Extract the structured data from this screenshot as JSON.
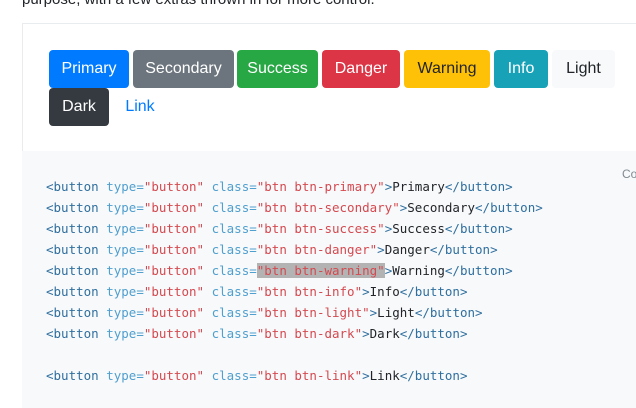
{
  "intro_text": "purpose, with a few extras thrown in for more control.",
  "buttons": [
    {
      "label": "Primary",
      "variant": "primary"
    },
    {
      "label": "Secondary",
      "variant": "secondary"
    },
    {
      "label": "Success",
      "variant": "success"
    },
    {
      "label": "Danger",
      "variant": "danger"
    },
    {
      "label": "Warning",
      "variant": "warning"
    },
    {
      "label": "Info",
      "variant": "info"
    },
    {
      "label": "Light",
      "variant": "light"
    },
    {
      "label": "Dark",
      "variant": "dark"
    },
    {
      "label": "Link",
      "variant": "link"
    }
  ],
  "copy_label": "Co",
  "code": {
    "tag_open": "<button",
    "type_attr": " type=",
    "type_val": "\"button\"",
    "class_attr": " class=",
    "gt": ">",
    "tag_close": "</button>",
    "lines": [
      {
        "cls": "\"btn btn-primary\"",
        "text": "Primary"
      },
      {
        "cls": "\"btn btn-secondary\"",
        "text": "Secondary"
      },
      {
        "cls": "\"btn btn-success\"",
        "text": "Success"
      },
      {
        "cls": "\"btn btn-danger\"",
        "text": "Danger"
      },
      {
        "cls": "\"btn btn-warning\"",
        "text": "Warning"
      },
      {
        "cls": "\"btn btn-info\"",
        "text": "Info"
      },
      {
        "cls": "\"btn btn-light\"",
        "text": "Light"
      },
      {
        "cls": "\"btn btn-dark\"",
        "text": "Dark"
      },
      {
        "cls": "\"btn btn-link\"",
        "text": "Link"
      }
    ]
  },
  "colors": {
    "primary": "#007bff",
    "secondary": "#6c757d",
    "success": "#28a745",
    "danger": "#dc3545",
    "warning": "#ffc107",
    "info": "#17a2b8",
    "light": "#f8f9fa",
    "dark": "#343a40",
    "link": "#007bff"
  }
}
